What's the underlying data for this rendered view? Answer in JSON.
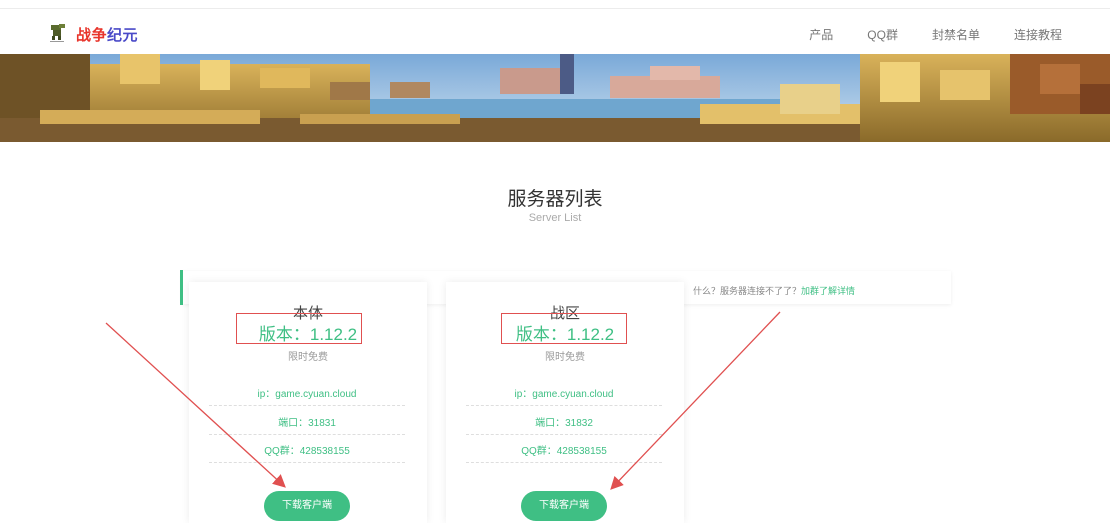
{
  "header": {
    "brand_part1": "战争",
    "brand_part2": "纪元",
    "nav": [
      "产品",
      "QQ群",
      "封禁名单",
      "连接教程"
    ]
  },
  "section": {
    "title": "服务器列表",
    "subtitle": "Server List"
  },
  "notice": {
    "text": "什么？服务器连接不了了？",
    "link": "加群了解详情"
  },
  "servers": [
    {
      "name": "本体",
      "version": "版本：1.12.2",
      "free": "限时免费",
      "ip": "ip：game.cyuan.cloud",
      "port": "端口：31831",
      "qq": "QQ群：428538155",
      "download": "下载客户端"
    },
    {
      "name": "战区",
      "version": "版本：1.12.2",
      "free": "限时免费",
      "ip": "ip：game.cyuan.cloud",
      "port": "端口：31832",
      "qq": "QQ群：428538155",
      "download": "下载客户端"
    }
  ],
  "colors": {
    "accent": "#3fbf84",
    "brand_red": "#e8342b",
    "brand_blue": "#4a4ac8",
    "annotation_red": "#e05050"
  }
}
